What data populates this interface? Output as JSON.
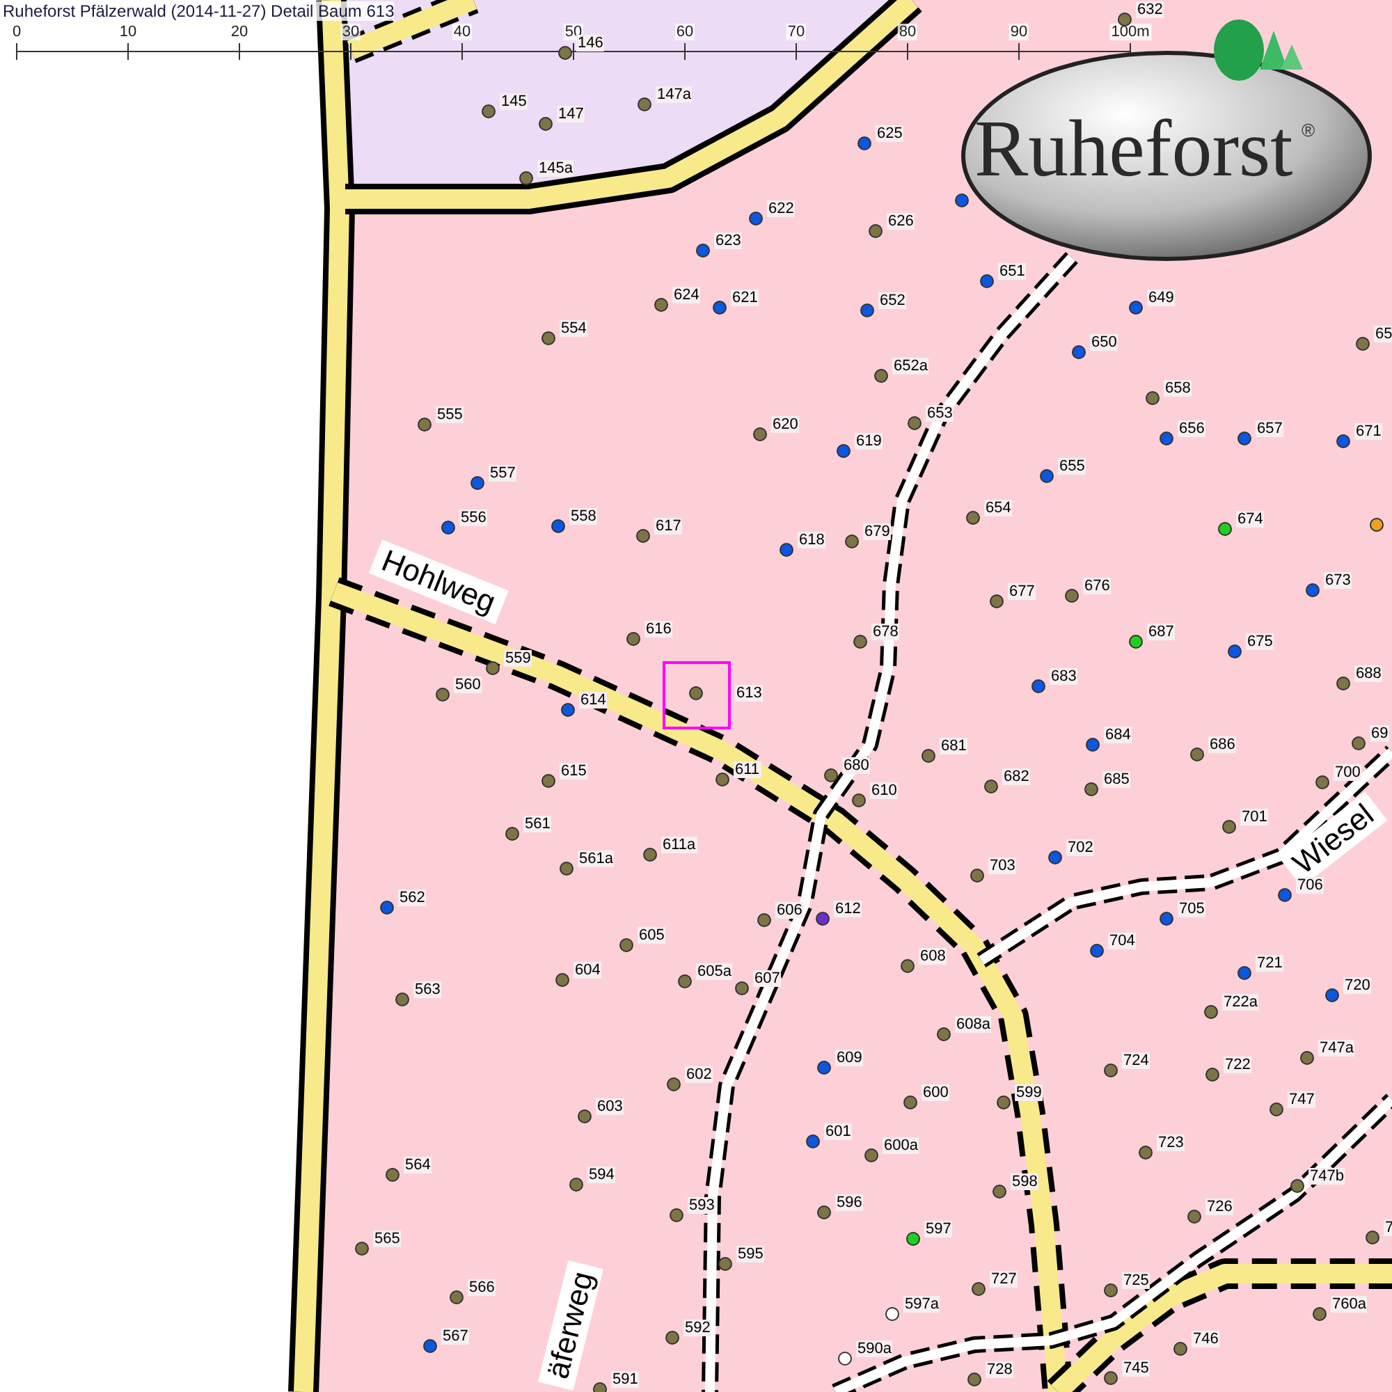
{
  "title": "Ruheforst Pfälzerwald (2014-11-27) Detail  Baum 613",
  "scale": {
    "ticks": [
      "0",
      "10",
      "20",
      "30",
      "40",
      "50",
      "60",
      "70",
      "80",
      "90",
      "100m"
    ]
  },
  "logo": {
    "name": "Ruheforst",
    "mark": "®"
  },
  "roads": [
    {
      "name": "Hohlweg"
    },
    {
      "name": "Wiesel"
    },
    {
      "name": "äferweg"
    }
  ],
  "trees": [
    {
      "label": "146",
      "color": "#7d7545",
      "selected": false
    },
    {
      "label": "145",
      "color": "#7d7545",
      "selected": false
    },
    {
      "label": "147",
      "color": "#7d7545",
      "selected": false
    },
    {
      "label": "147a",
      "color": "#7d7545",
      "selected": false
    },
    {
      "label": "145a",
      "color": "#7d7545",
      "selected": false
    },
    {
      "label": "632",
      "color": "#7d7545",
      "selected": false
    },
    {
      "label": "625",
      "color": "#0a58e0",
      "selected": false
    },
    {
      "color": "#0a58e0",
      "selected": false
    },
    {
      "label": "622",
      "color": "#0a58e0",
      "selected": false
    },
    {
      "label": "626",
      "color": "#7d7545",
      "selected": false
    },
    {
      "label": "623",
      "color": "#0a58e0",
      "selected": false
    },
    {
      "label": "624",
      "color": "#7d7545",
      "selected": false
    },
    {
      "label": "621",
      "color": "#0a58e0",
      "selected": false
    },
    {
      "label": "652",
      "color": "#0a58e0",
      "selected": false
    },
    {
      "label": "651",
      "color": "#0a58e0",
      "selected": false
    },
    {
      "label": "649",
      "color": "#0a58e0",
      "selected": false
    },
    {
      "label": "554",
      "color": "#7d7545",
      "selected": false
    },
    {
      "label": "650",
      "color": "#0a58e0",
      "selected": false
    },
    {
      "label": "65",
      "color": "#7d7545",
      "selected": false
    },
    {
      "label": "652a",
      "color": "#7d7545",
      "selected": false
    },
    {
      "label": "658",
      "color": "#7d7545",
      "selected": false
    },
    {
      "label": "555",
      "color": "#7d7545",
      "selected": false
    },
    {
      "label": "620",
      "color": "#7d7545",
      "selected": false
    },
    {
      "label": "653",
      "color": "#7d7545",
      "selected": false
    },
    {
      "label": "619",
      "color": "#0a58e0",
      "selected": false
    },
    {
      "label": "656",
      "color": "#0a58e0",
      "selected": false
    },
    {
      "label": "657",
      "color": "#0a58e0",
      "selected": false
    },
    {
      "label": "671",
      "color": "#0a58e0",
      "selected": false
    },
    {
      "label": "557",
      "color": "#0a58e0",
      "selected": false
    },
    {
      "label": "655",
      "color": "#0a58e0",
      "selected": false
    },
    {
      "label": "556",
      "color": "#0a58e0",
      "selected": false
    },
    {
      "label": "558",
      "color": "#0a58e0",
      "selected": false
    },
    {
      "label": "617",
      "color": "#7d7545",
      "selected": false
    },
    {
      "label": "654",
      "color": "#7d7545",
      "selected": false
    },
    {
      "label": "674",
      "color": "#1fd01f",
      "selected": false
    },
    {
      "color": "#f0a020",
      "selected": false
    },
    {
      "label": "618",
      "color": "#0a58e0",
      "selected": false
    },
    {
      "label": "679",
      "color": "#7d7545",
      "selected": false
    },
    {
      "label": "677",
      "color": "#7d7545",
      "selected": false
    },
    {
      "label": "676",
      "color": "#7d7545",
      "selected": false
    },
    {
      "label": "673",
      "color": "#0a58e0",
      "selected": false
    },
    {
      "label": "616",
      "color": "#7d7545",
      "selected": false
    },
    {
      "label": "678",
      "color": "#7d7545",
      "selected": false
    },
    {
      "label": "687",
      "color": "#1fd01f",
      "selected": false
    },
    {
      "label": "675",
      "color": "#0a58e0",
      "selected": false
    },
    {
      "label": "559",
      "color": "#7d7545",
      "selected": false
    },
    {
      "label": "613",
      "color": "#7d7545",
      "selected": true
    },
    {
      "label": "683",
      "color": "#0a58e0",
      "selected": false
    },
    {
      "label": "688",
      "color": "#7d7545",
      "selected": false
    },
    {
      "label": "560",
      "color": "#7d7545",
      "selected": false
    },
    {
      "label": "614",
      "color": "#0a58e0",
      "selected": false
    },
    {
      "label": "684",
      "color": "#0a58e0",
      "selected": false
    },
    {
      "label": "686",
      "color": "#7d7545",
      "selected": false
    },
    {
      "label": "69",
      "color": "#7d7545",
      "selected": false
    },
    {
      "label": "611",
      "color": "#7d7545",
      "selected": false
    },
    {
      "label": "680",
      "color": "#7d7545",
      "selected": false
    },
    {
      "label": "681",
      "color": "#7d7545",
      "selected": false
    },
    {
      "label": "682",
      "color": "#7d7545",
      "selected": false
    },
    {
      "label": "685",
      "color": "#7d7545",
      "selected": false
    },
    {
      "label": "700",
      "color": "#7d7545",
      "selected": false
    },
    {
      "label": "610",
      "color": "#7d7545",
      "selected": false
    },
    {
      "label": "615",
      "color": "#7d7545",
      "selected": false
    },
    {
      "label": "701",
      "color": "#7d7545",
      "selected": false
    },
    {
      "label": "561",
      "color": "#7d7545",
      "selected": false
    },
    {
      "label": "702",
      "color": "#0a58e0",
      "selected": false
    },
    {
      "label": "611a",
      "color": "#7d7545",
      "selected": false
    },
    {
      "label": "561a",
      "color": "#7d7545",
      "selected": false
    },
    {
      "label": "703",
      "color": "#7d7545",
      "selected": false
    },
    {
      "label": "706",
      "color": "#0a58e0",
      "selected": false
    },
    {
      "label": "562",
      "color": "#0a58e0",
      "selected": false
    },
    {
      "label": "606",
      "color": "#7d7545",
      "selected": false
    },
    {
      "label": "612",
      "color": "#6b2fc8",
      "selected": false
    },
    {
      "label": "705",
      "color": "#0a58e0",
      "selected": false
    },
    {
      "label": "605",
      "color": "#7d7545",
      "selected": false
    },
    {
      "label": "704",
      "color": "#0a58e0",
      "selected": false
    },
    {
      "label": "608",
      "color": "#7d7545",
      "selected": false
    },
    {
      "label": "721",
      "color": "#0a58e0",
      "selected": false
    },
    {
      "label": "604",
      "color": "#7d7545",
      "selected": false
    },
    {
      "label": "605a",
      "color": "#7d7545",
      "selected": false
    },
    {
      "label": "607",
      "color": "#7d7545",
      "selected": false
    },
    {
      "label": "563",
      "color": "#7d7545",
      "selected": false
    },
    {
      "label": "720",
      "color": "#0a58e0",
      "selected": false
    },
    {
      "label": "722a",
      "color": "#7d7545",
      "selected": false
    },
    {
      "label": "608a",
      "color": "#7d7545",
      "selected": false
    },
    {
      "label": "747a",
      "color": "#7d7545",
      "selected": false
    },
    {
      "label": "609",
      "color": "#0a58e0",
      "selected": false
    },
    {
      "label": "724",
      "color": "#7d7545",
      "selected": false
    },
    {
      "label": "722",
      "color": "#7d7545",
      "selected": false
    },
    {
      "label": "602",
      "color": "#7d7545",
      "selected": false
    },
    {
      "label": "600",
      "color": "#7d7545",
      "selected": false
    },
    {
      "label": "599",
      "color": "#7d7545",
      "selected": false
    },
    {
      "label": "747",
      "color": "#7d7545",
      "selected": false
    },
    {
      "label": "603",
      "color": "#7d7545",
      "selected": false
    },
    {
      "label": "601",
      "color": "#0a58e0",
      "selected": false
    },
    {
      "label": "600a",
      "color": "#7d7545",
      "selected": false
    },
    {
      "label": "723",
      "color": "#7d7545",
      "selected": false
    },
    {
      "label": "564",
      "color": "#7d7545",
      "selected": false
    },
    {
      "label": "594",
      "color": "#7d7545",
      "selected": false
    },
    {
      "label": "747b",
      "color": "#7d7545",
      "selected": false
    },
    {
      "label": "598",
      "color": "#7d7545",
      "selected": false
    },
    {
      "label": "593",
      "color": "#7d7545",
      "selected": false
    },
    {
      "label": "596",
      "color": "#7d7545",
      "selected": false
    },
    {
      "label": "726",
      "color": "#7d7545",
      "selected": false
    },
    {
      "label": "7",
      "color": "#7d7545",
      "selected": false
    },
    {
      "label": "597",
      "color": "#1fd01f",
      "selected": false
    },
    {
      "label": "565",
      "color": "#7d7545",
      "selected": false
    },
    {
      "label": "595",
      "color": "#7d7545",
      "selected": false
    },
    {
      "label": "727",
      "color": "#7d7545",
      "selected": false
    },
    {
      "label": "725",
      "color": "#7d7545",
      "selected": false
    },
    {
      "label": "566",
      "color": "#7d7545",
      "selected": false
    },
    {
      "label": "597a",
      "color": "#ffffff",
      "selected": false
    },
    {
      "label": "760a",
      "color": "#7d7545",
      "selected": false
    },
    {
      "label": "592",
      "color": "#7d7545",
      "selected": false
    },
    {
      "label": "746",
      "color": "#7d7545",
      "selected": false
    },
    {
      "label": "567",
      "color": "#0a58e0",
      "selected": false
    },
    {
      "label": "590a",
      "color": "#ffffff",
      "selected": false
    },
    {
      "label": "728",
      "color": "#7d7545",
      "selected": false
    },
    {
      "label": "745",
      "color": "#7d7545",
      "selected": false
    },
    {
      "label": "591",
      "color": "#7d7545",
      "selected": false
    }
  ]
}
